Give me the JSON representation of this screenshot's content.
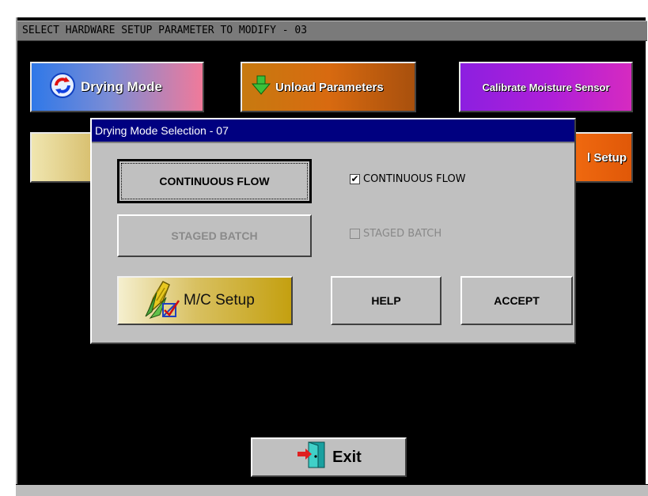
{
  "main_title": "SELECT HARDWARE SETUP PARAMETER TO MODIFY - 03",
  "buttons": {
    "drying_mode": "Drying Mode",
    "unload_parameters": "Unload Parameters",
    "calibrate_moisture_sensor": "Calibrate Moisture Sensor",
    "partial_setup": "l Setup",
    "exit": "Exit"
  },
  "dialog": {
    "title": "Drying Mode Selection - 07",
    "continuous_flow_button": "CONTINUOUS FLOW",
    "staged_batch_button": "STAGED BATCH",
    "continuous_flow_check": "CONTINUOUS FLOW",
    "continuous_flow_checked": true,
    "staged_batch_check": "STAGED BATCH",
    "staged_batch_checked": false,
    "mc_setup_button": "M/C Setup",
    "help_button": "HELP",
    "accept_button": "ACCEPT"
  },
  "icons": [
    "refresh-icon",
    "download-arrow-icon",
    "corn-icon",
    "exit-door-icon"
  ],
  "colors": {
    "dialog_title_bg": "#000080",
    "background": "#000000",
    "face": "#c0c0c0"
  }
}
